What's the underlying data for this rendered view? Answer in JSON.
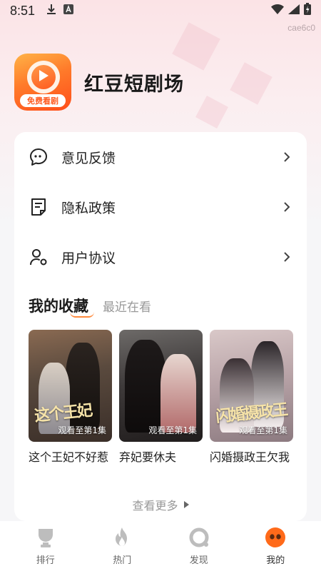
{
  "status_bar": {
    "time": "8:51",
    "device_id": "cae6c0"
  },
  "app": {
    "logo_badge": "免费看剧",
    "title": "红豆短剧场"
  },
  "menu": [
    {
      "label": "意见反馈",
      "icon": "chat-bubble-icon"
    },
    {
      "label": "隐私政策",
      "icon": "document-icon"
    },
    {
      "label": "用户协议",
      "icon": "user-agreement-icon"
    }
  ],
  "tabs": {
    "active": "我的收藏",
    "inactive": "最近在看"
  },
  "posters": [
    {
      "art_title": "这个王妃",
      "progress": "观看至第1集",
      "name": "这个王妃不好惹"
    },
    {
      "art_title": "",
      "progress": "观看至第1集",
      "name": "弃妃要休夫"
    },
    {
      "art_title": "闪婚摄政王",
      "progress": "观看至第1集",
      "name": "闪婚摄政王欠我"
    }
  ],
  "see_more": "查看更多",
  "bottom_nav": [
    {
      "label": "排行",
      "icon": "trophy-icon"
    },
    {
      "label": "热门",
      "icon": "flame-icon"
    },
    {
      "label": "发现",
      "icon": "discover-icon"
    },
    {
      "label": "我的",
      "icon": "profile-face-icon"
    }
  ],
  "colors": {
    "accent": "#ff6a1a",
    "tab_underline": "#ff8a3d",
    "muted_text": "#999999"
  }
}
